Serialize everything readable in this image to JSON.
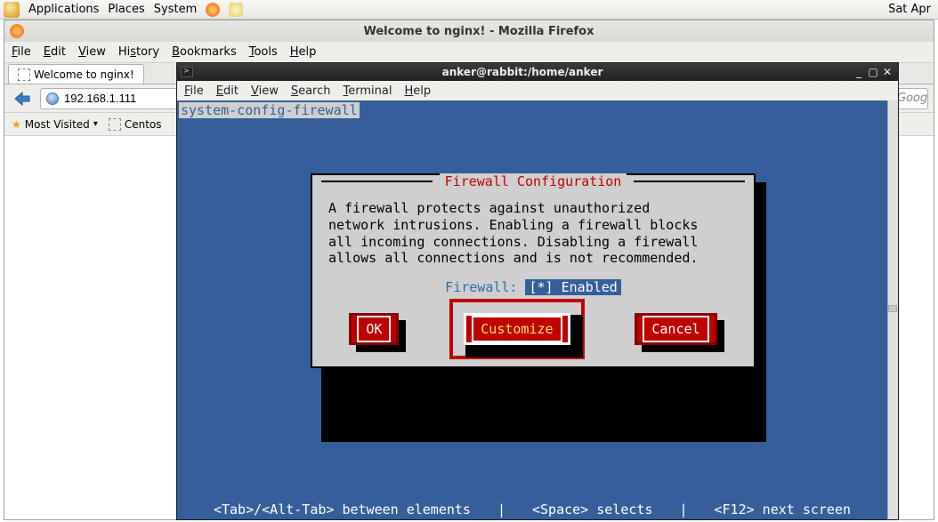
{
  "panel": {
    "apps": "Applications",
    "places": "Places",
    "system": "System",
    "clock": "Sat Apr"
  },
  "firefox": {
    "title": "Welcome to nginx! - Mozilla Firefox",
    "menu": {
      "file": "File",
      "edit": "Edit",
      "view": "View",
      "history": "History",
      "bookmarks": "Bookmarks",
      "tools": "Tools",
      "help": "Help"
    },
    "tab": "Welcome to nginx!",
    "url": "192.168.1.111",
    "search_placeholder": "Google",
    "bookmarks": {
      "most_visited": "Most Visited",
      "centos": "Centos"
    }
  },
  "terminal": {
    "title": "anker@rabbit:/home/anker",
    "menu": {
      "file": "File",
      "edit": "Edit",
      "view": "View",
      "search": "Search",
      "terminal": "Terminal",
      "help": "Help"
    },
    "app_name": "system-config-firewall",
    "dialog": {
      "title": "Firewall Configuration",
      "body": "A firewall protects against unauthorized\nnetwork intrusions. Enabling a firewall blocks\nall incoming connections. Disabling a firewall\nallows all connections and is not recommended.",
      "fw_label": "Firewall: ",
      "fw_value": "[*] Enabled",
      "buttons": {
        "ok": "OK",
        "customize": "Customize",
        "cancel": "Cancel"
      }
    },
    "footer": {
      "tab": "<Tab>/<Alt-Tab> between elements",
      "sep": "|",
      "space": "<Space> selects",
      "f12": "<F12> next screen"
    }
  }
}
